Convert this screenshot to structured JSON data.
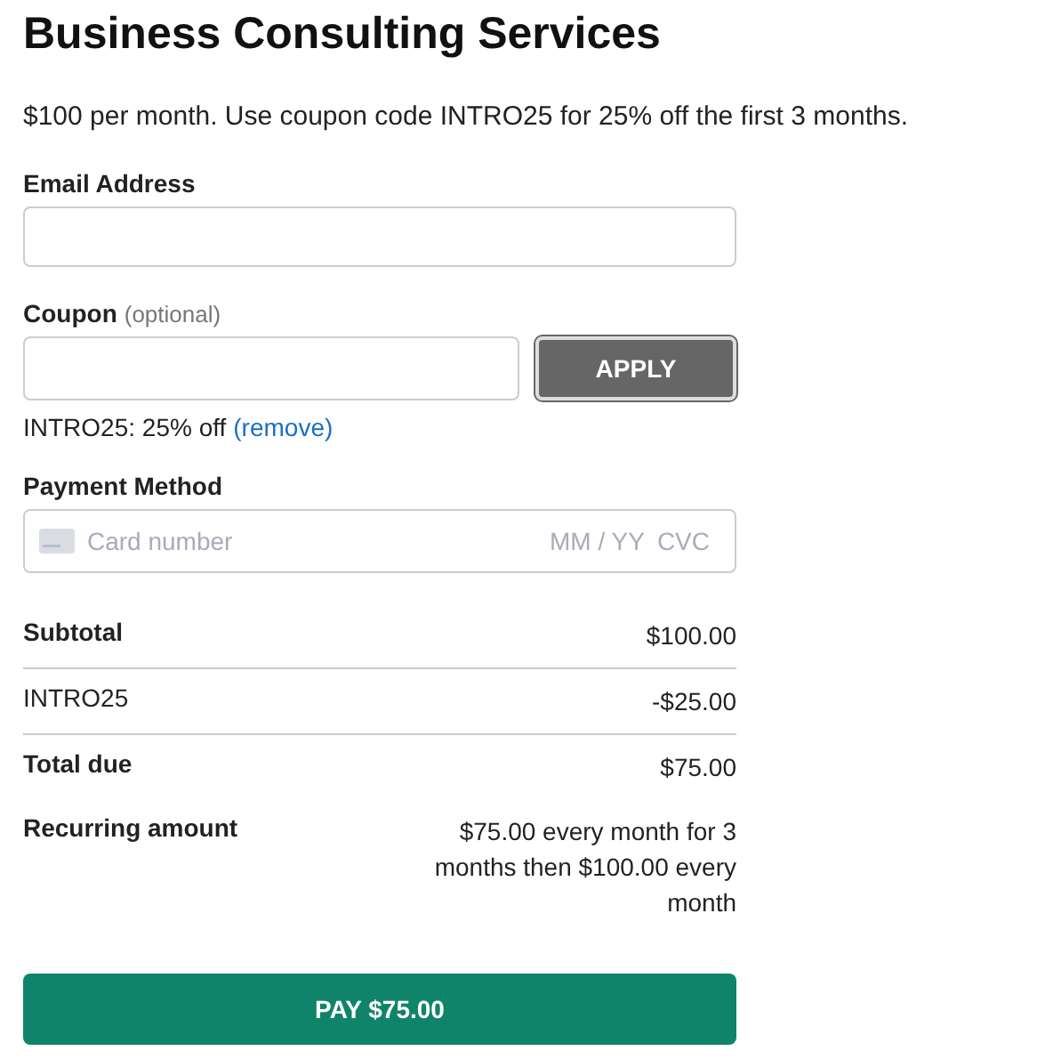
{
  "title": "Business Consulting Services",
  "description": "$100 per month. Use coupon code INTRO25 for 25% off the first 3 months.",
  "email": {
    "label": "Email Address"
  },
  "coupon": {
    "label": "Coupon",
    "hint": "(optional)",
    "button": "APPLY",
    "applied_note": "INTRO25: 25% off",
    "remove_link": "(remove)"
  },
  "payment": {
    "label": "Payment Method",
    "placeholder": "Card number",
    "expiry_placeholder": "MM / YY",
    "cvc_placeholder": "CVC"
  },
  "summary": [
    {
      "kind": "subtotal",
      "label": "Subtotal",
      "value": "$100.00"
    },
    {
      "kind": "discount",
      "label": "INTRO25",
      "value": "-$25.00"
    },
    {
      "kind": "total",
      "label": "Total due",
      "value": "$75.00"
    },
    {
      "kind": "recurring",
      "label": "Recurring amount",
      "value": "$75.00 every month for 3 months then $100.00 every month"
    }
  ],
  "pay_button": "PAY $75.00"
}
